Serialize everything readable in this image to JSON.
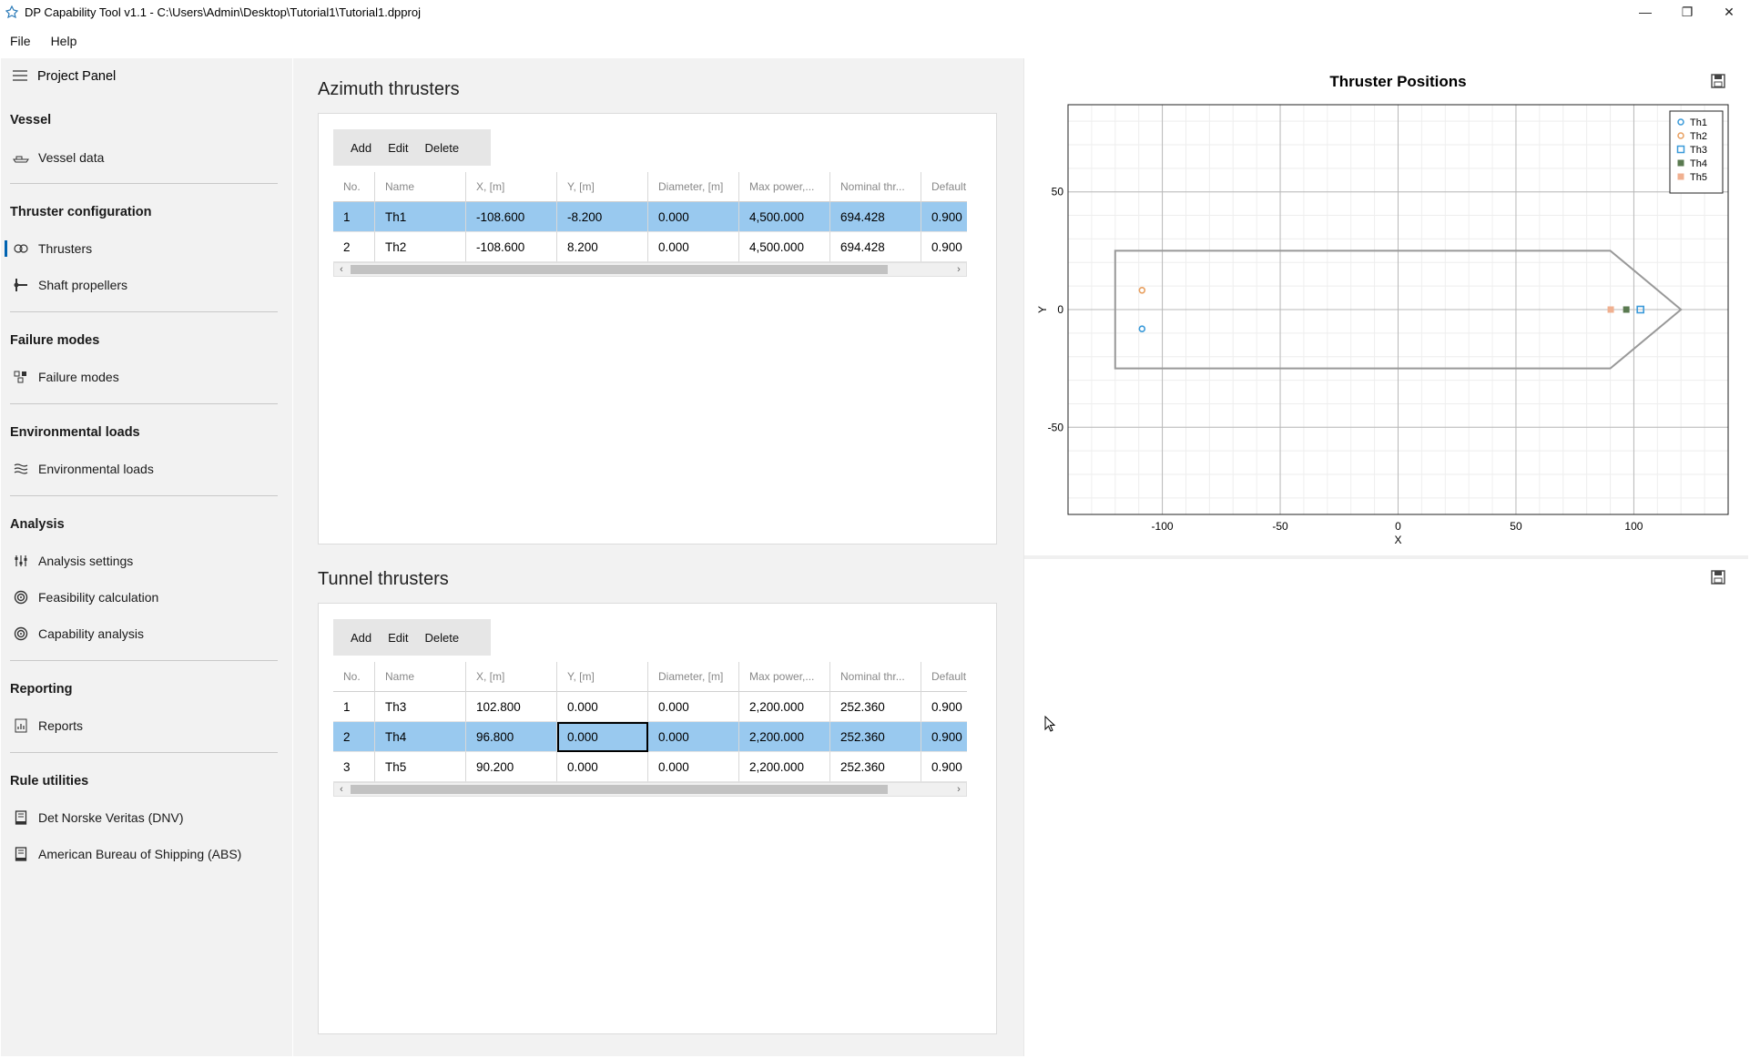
{
  "window": {
    "title": "DP Capability Tool v1.1 - C:\\Users\\Admin\\Desktop\\Tutorial1\\Tutorial1.dpproj",
    "minimize": "—",
    "maximize": "❐",
    "close": "✕"
  },
  "menu": {
    "file": "File",
    "help": "Help"
  },
  "sidebar": {
    "header": "Project Panel",
    "sections": {
      "vessel": "Vessel",
      "thruster_config": "Thruster configuration",
      "failure_modes": "Failure modes",
      "environmental": "Environmental loads",
      "analysis": "Analysis",
      "reporting": "Reporting",
      "rule_utilities": "Rule utilities"
    },
    "items": {
      "vessel_data": "Vessel data",
      "thrusters": "Thrusters",
      "shaft_propellers": "Shaft propellers",
      "failure_modes": "Failure modes",
      "environmental_loads": "Environmental loads",
      "analysis_settings": "Analysis settings",
      "feasibility": "Feasibility calculation",
      "capability": "Capability analysis",
      "reports": "Reports",
      "dnv": "Det Norske Veritas (DNV)",
      "abs": "American Bureau of Shipping (ABS)"
    }
  },
  "azimuth": {
    "title": "Azimuth thrusters",
    "toolbar": {
      "add": "Add",
      "edit": "Edit",
      "delete": "Delete"
    },
    "columns": [
      "No.",
      "Name",
      "X, [m]",
      "Y, [m]",
      "Diameter, [m]",
      "Max power,...",
      "Nominal thr...",
      "Default th"
    ],
    "rows": [
      [
        "1",
        "Th1",
        "-108.600",
        "-8.200",
        "0.000",
        "4,500.000",
        "694.428",
        "0.900"
      ],
      [
        "2",
        "Th2",
        "-108.600",
        "8.200",
        "0.000",
        "4,500.000",
        "694.428",
        "0.900"
      ]
    ],
    "selected_row": 0
  },
  "tunnel": {
    "title": "Tunnel thrusters",
    "toolbar": {
      "add": "Add",
      "edit": "Edit",
      "delete": "Delete"
    },
    "columns": [
      "No.",
      "Name",
      "X, [m]",
      "Y, [m]",
      "Diameter, [m]",
      "Max power,...",
      "Nominal thr...",
      "Default th"
    ],
    "rows": [
      [
        "1",
        "Th3",
        "102.800",
        "0.000",
        "0.000",
        "2,200.000",
        "252.360",
        "0.900"
      ],
      [
        "2",
        "Th4",
        "96.800",
        "0.000",
        "0.000",
        "2,200.000",
        "252.360",
        "0.900"
      ],
      [
        "3",
        "Th5",
        "90.200",
        "0.000",
        "0.000",
        "2,200.000",
        "252.360",
        "0.900"
      ]
    ],
    "selected_row": 1
  },
  "chart_data": {
    "type": "scatter",
    "title": "Thruster Positions",
    "xlabel": "X",
    "ylabel": "Y",
    "xlim": [
      -140,
      140
    ],
    "ylim": [
      -87,
      87
    ],
    "xticks": [
      -100,
      -50,
      0,
      50,
      100
    ],
    "yticks": [
      50,
      0,
      -50
    ],
    "grid": true,
    "legend_position": "top-right",
    "hull_outline": [
      [
        -120,
        25
      ],
      [
        90,
        25
      ],
      [
        120,
        0
      ],
      [
        90,
        -25
      ],
      [
        -120,
        -25
      ]
    ],
    "series": [
      {
        "name": "Th1",
        "x": [
          -108.6
        ],
        "y": [
          -8.2
        ],
        "marker": "circle-open",
        "color": "#3a9ad9"
      },
      {
        "name": "Th2",
        "x": [
          -108.6
        ],
        "y": [
          8.2
        ],
        "marker": "circle-open",
        "color": "#e8a060"
      },
      {
        "name": "Th3",
        "x": [
          102.8
        ],
        "y": [
          0
        ],
        "marker": "square-open",
        "color": "#3a9ad9"
      },
      {
        "name": "Th4",
        "x": [
          96.8
        ],
        "y": [
          0
        ],
        "marker": "square",
        "color": "#5a7a50"
      },
      {
        "name": "Th5",
        "x": [
          90.2
        ],
        "y": [
          0
        ],
        "marker": "square",
        "color": "#f0b090"
      }
    ]
  }
}
